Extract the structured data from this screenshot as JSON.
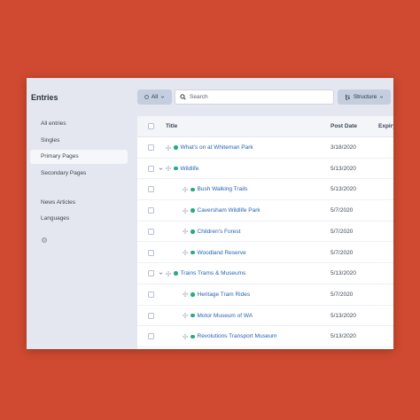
{
  "sidebar": {
    "title": "Entries",
    "items": [
      {
        "label": "All entries",
        "active": false
      },
      {
        "label": "Singles",
        "active": false
      },
      {
        "label": "Primary Pages",
        "active": true
      },
      {
        "label": "Secondary Pages",
        "active": false
      },
      {
        "label": "News Articles",
        "active": false
      },
      {
        "label": "Languages",
        "active": false
      }
    ],
    "settings_icon": "gear-icon"
  },
  "toolbar": {
    "status_filter_label": "All",
    "search_placeholder": "Search",
    "search_value": "",
    "view_mode_label": "Structure"
  },
  "table": {
    "columns": [
      "Title",
      "Post Date",
      "Expiry"
    ],
    "rows": [
      {
        "title": "What's on at Whiteman Park",
        "post_date": "3/18/2020",
        "level": 1,
        "has_children": false
      },
      {
        "title": "Wildlife",
        "post_date": "5/13/2020",
        "level": 1,
        "has_children": true
      },
      {
        "title": "Bush Walking Trails",
        "post_date": "5/13/2020",
        "level": 2,
        "has_children": false
      },
      {
        "title": "Caversham Wildlife Park",
        "post_date": "5/7/2020",
        "level": 2,
        "has_children": false
      },
      {
        "title": "Children's Forest",
        "post_date": "5/7/2020",
        "level": 2,
        "has_children": false
      },
      {
        "title": "Woodland Reserve",
        "post_date": "5/7/2020",
        "level": 2,
        "has_children": false
      },
      {
        "title": "Trains Trams & Museums",
        "post_date": "5/13/2020",
        "level": 1,
        "has_children": true
      },
      {
        "title": "Heritage Tram Rides",
        "post_date": "5/7/2020",
        "level": 2,
        "has_children": false
      },
      {
        "title": "Motor Museum of WA",
        "post_date": "5/13/2020",
        "level": 2,
        "has_children": false
      },
      {
        "title": "Revolutions Transport Museum",
        "post_date": "5/13/2020",
        "level": 2,
        "has_children": false
      }
    ]
  },
  "colors": {
    "background": "#cf4a30",
    "status_live": "#27ab83",
    "link": "#2763b8",
    "sidebar": "#e4e7ef"
  }
}
